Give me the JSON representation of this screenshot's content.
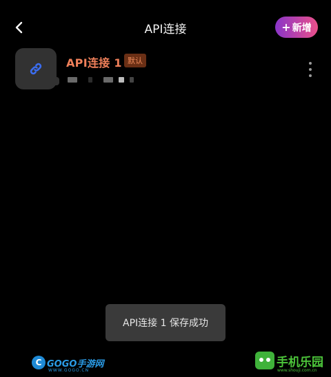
{
  "header": {
    "title": "API连接",
    "back_icon": "chevron-left-icon",
    "add_button": {
      "plus": "+",
      "label": "新增"
    }
  },
  "connection": {
    "name": "API连接 1",
    "badge": "默认",
    "icon": "link-icon",
    "accent_color": "#f0805a"
  },
  "toast": {
    "message": "API连接 1 保存成功"
  },
  "watermarks": {
    "left": {
      "logo": "C",
      "text": "GOGO手游网",
      "sub": "WWW.GOGO.CN"
    },
    "right": {
      "text": "手机乐园",
      "sub": "www.shouji.com.cn"
    }
  },
  "colors": {
    "background": "#000000",
    "add_gradient_start": "#8a35c9",
    "add_gradient_end": "#ea5089",
    "link_icon": "#3b6df0",
    "badge_bg": "#6a2f15"
  }
}
